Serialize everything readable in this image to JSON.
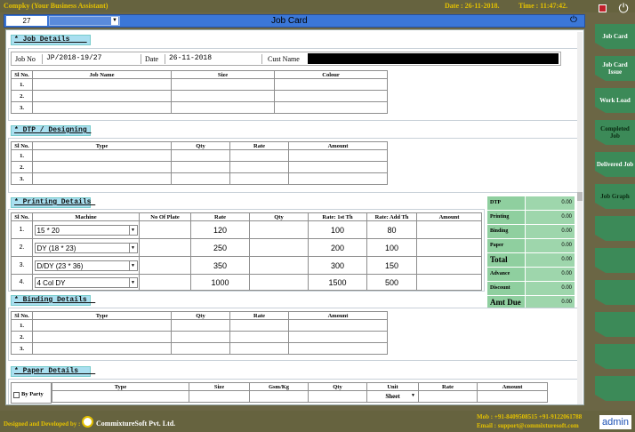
{
  "app": {
    "name": "Compky (Your Business Assistant)",
    "date_text": "Date : 26-11-2018.",
    "time_text": "Time : 11:47:42."
  },
  "window": {
    "job_number": "27",
    "selector_value": "",
    "title": "Job Card"
  },
  "job_details": {
    "header": "* Job Details    ",
    "job_no_label": "Job No",
    "job_no": "JP/2018-19/27",
    "date_label": "Date",
    "date": "26-11-2018",
    "cust_label": "Cust Name",
    "cust_value": "",
    "columns": [
      "Sl No.",
      "Job Name",
      "Size",
      "Colour"
    ],
    "rows": [
      "1.",
      "2.",
      "3."
    ]
  },
  "dtp": {
    "header": "* DTP / Designing ",
    "columns": [
      "Sl No.",
      "Type",
      "Qty",
      "Rate",
      "Amount"
    ],
    "rows": [
      "1.",
      "2.",
      "3."
    ]
  },
  "printing": {
    "header": "* Printing Details ",
    "columns": [
      "Sl No.",
      "Machine",
      "No Of Plate",
      "Rate",
      "Qty",
      "Rate: 1st Th",
      "Rate: Add Th",
      "Amount"
    ],
    "rows": [
      {
        "sl": "1.",
        "machine": "15 * 20",
        "plate": "",
        "rate": "120",
        "qty": "",
        "rate1": "100",
        "rateadd": "80",
        "amount": ""
      },
      {
        "sl": "2.",
        "machine": "DY (18 * 23)",
        "plate": "",
        "rate": "250",
        "qty": "",
        "rate1": "200",
        "rateadd": "100",
        "amount": ""
      },
      {
        "sl": "3.",
        "machine": "D/DY (23 * 36)",
        "plate": "",
        "rate": "350",
        "qty": "",
        "rate1": "300",
        "rateadd": "150",
        "amount": ""
      },
      {
        "sl": "4.",
        "machine": "4 Col DY",
        "plate": "",
        "rate": "1000",
        "qty": "",
        "rate1": "1500",
        "rateadd": "500",
        "amount": ""
      }
    ]
  },
  "summary": [
    {
      "label": "DTP",
      "value": "0.00"
    },
    {
      "label": "Printing",
      "value": "0.00"
    },
    {
      "label": "Binding",
      "value": "0.00"
    },
    {
      "label": "Paper",
      "value": "0.00"
    },
    {
      "label": "Total",
      "value": "0.00"
    },
    {
      "label": "Advance",
      "value": "0.00"
    },
    {
      "label": "Discount",
      "value": "0.00"
    },
    {
      "label": "Amt Due",
      "value": "0.00"
    }
  ],
  "binding": {
    "header": "* Binding Details  ",
    "columns": [
      "Sl No.",
      "Type",
      "Qty",
      "Rate",
      "Amount"
    ],
    "rows": [
      "1.",
      "2.",
      "3."
    ]
  },
  "paper": {
    "header": "* Paper Details    ",
    "by_party": "By Party",
    "columns": [
      "Type",
      "Size",
      "Gsm/Kg",
      "Qty",
      "Unit",
      "Rate",
      "Amount"
    ],
    "unit_value": "Sheet"
  },
  "sidebar": [
    "Job Card",
    "Job Card Issue",
    "Work Load",
    "Completed Job",
    "Delivered Job",
    "Job Graph",
    "",
    "",
    "",
    "",
    "",
    ""
  ],
  "footer": {
    "designed": "Designed and Developed by :",
    "company": "CommixtureSoft Pvt. Ltd.",
    "mob": "Mob : +91-8409508515   +91-9122061788",
    "email": "Email : support@commixturesoft.com",
    "user": "admin"
  }
}
